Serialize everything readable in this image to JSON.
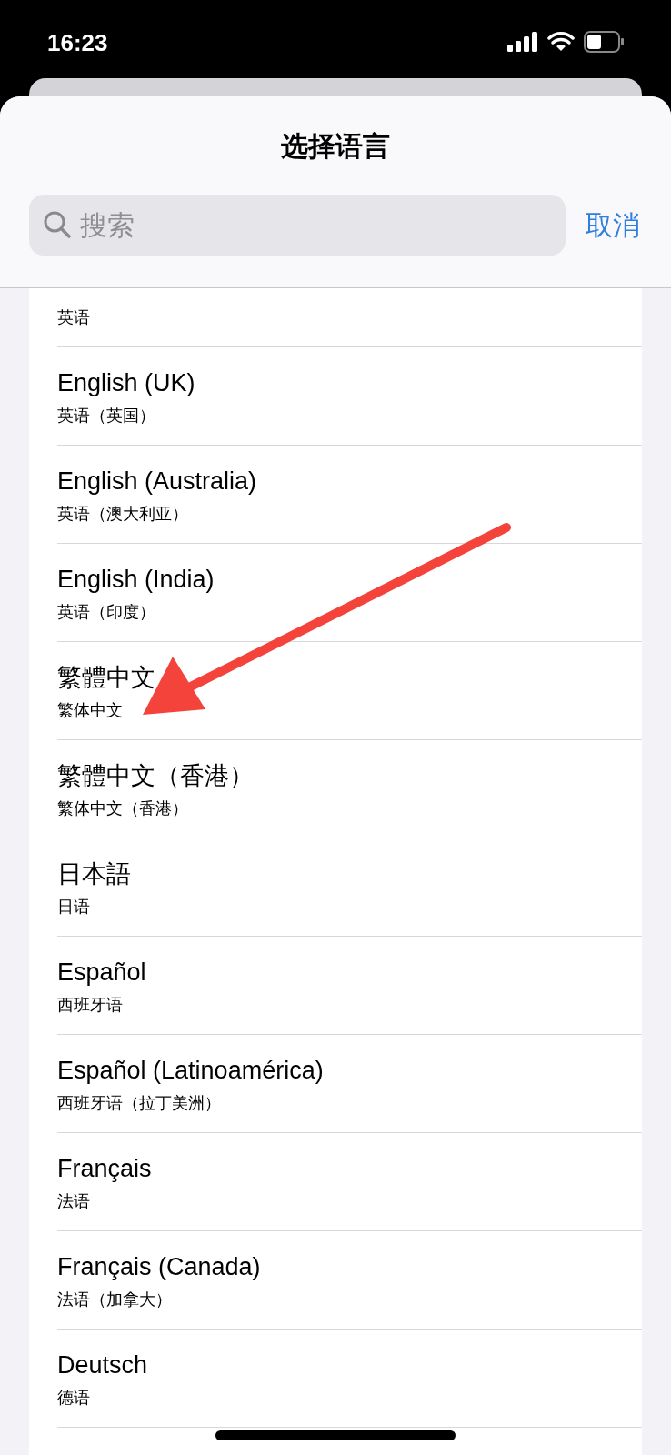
{
  "status_bar": {
    "time": "16:23"
  },
  "sheet": {
    "title": "选择语言",
    "search": {
      "placeholder": "搜索"
    },
    "cancel": "取消"
  },
  "languages": [
    {
      "subtitle": "英语"
    },
    {
      "name": "English (UK)",
      "subtitle": "英语（英国）"
    },
    {
      "name": "English (Australia)",
      "subtitle": "英语（澳大利亚）"
    },
    {
      "name": "English (India)",
      "subtitle": "英语（印度）"
    },
    {
      "name": "繁體中文",
      "subtitle": "繁体中文"
    },
    {
      "name": "繁體中文（香港）",
      "subtitle": "繁体中文（香港）"
    },
    {
      "name": "日本語",
      "subtitle": "日语"
    },
    {
      "name": "Español",
      "subtitle": "西班牙语"
    },
    {
      "name": "Español (Latinoamérica)",
      "subtitle": "西班牙语（拉丁美洲）"
    },
    {
      "name": "Français",
      "subtitle": "法语"
    },
    {
      "name": "Français (Canada)",
      "subtitle": "法语（加拿大）"
    },
    {
      "name": "Deutsch",
      "subtitle": "德语"
    }
  ]
}
